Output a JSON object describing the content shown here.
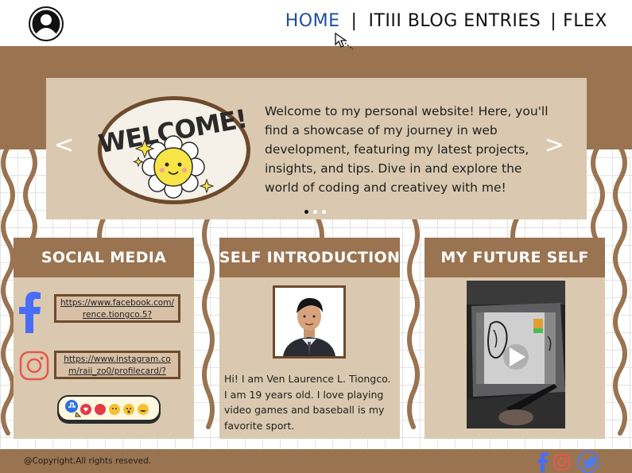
{
  "nav": {
    "items": [
      {
        "label": "HOME",
        "active": true
      },
      {
        "label": "ITIII BLOG ENTRIES",
        "active": false
      },
      {
        "label": "FLEX",
        "active": false
      }
    ],
    "separator": "|"
  },
  "hero": {
    "badge_text": "WELCOME!",
    "text": "Welcome to my personal website! Here, you'll find a showcase of my journey in web development, featuring my latest projects, insights, and tips. Dive in and explore the world of coding and creativey with me!",
    "prev_arrow": "<",
    "next_arrow": ">",
    "slide_count": 3,
    "active_slide": 1
  },
  "cards": {
    "social": {
      "title": "SOCIAL MEDIA",
      "facebook_link": "https://www.facebook.com/rence.tiongco.5?",
      "instagram_link": "https://www.instagram.com/raii_zo0/profilecard/?"
    },
    "intro": {
      "title": "SELF INTRODUCTION",
      "text": "Hi! I am Ven Laurence L. Tiongco. I am 19 years old. I love playing video games and baseball is my favorite sport."
    },
    "future": {
      "title": "MY FUTURE SELF"
    }
  },
  "footer": {
    "copyright": "@Copyright.All rights reseved."
  },
  "colors": {
    "brown": "#9a7350",
    "beige": "#dac9b0",
    "nav_active": "#1f4e9c",
    "facebook": "#4a6cf7",
    "instagram": "#e8574a",
    "twitter": "#4a7cf0"
  },
  "icons": [
    "user-avatar-icon",
    "pointer-cursor-icon",
    "facebook-icon",
    "instagram-icon",
    "reactions-sticker",
    "play-icon",
    "twitter-icon"
  ]
}
